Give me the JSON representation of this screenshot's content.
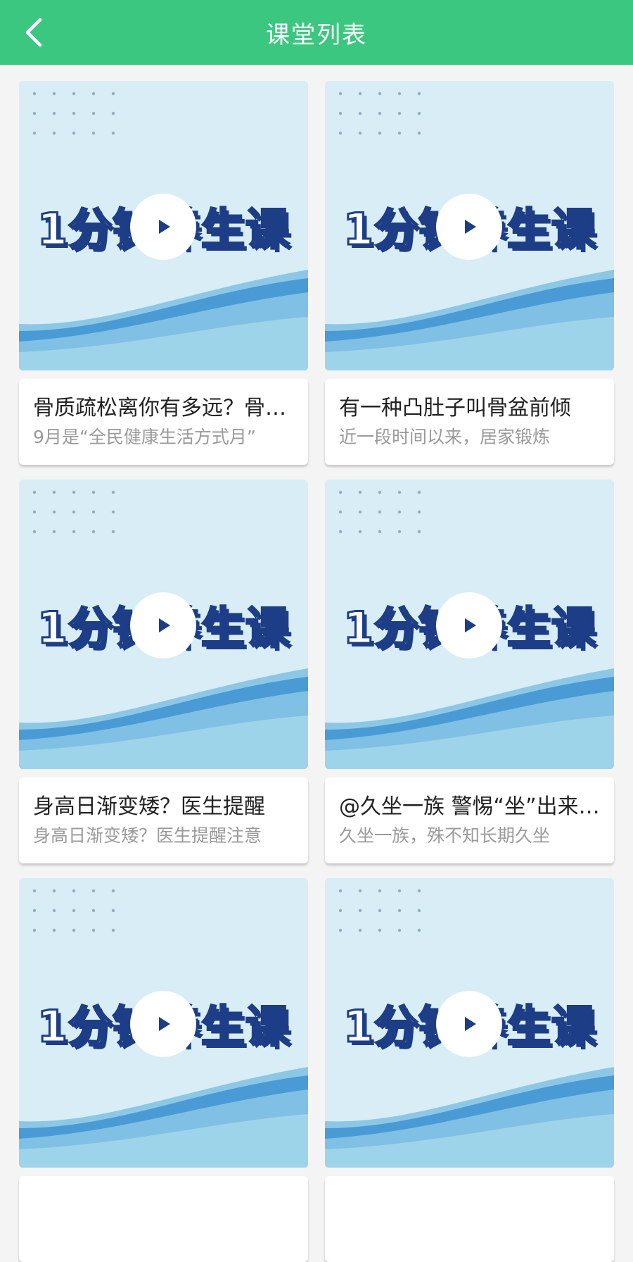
{
  "header": {
    "title": "课堂列表",
    "back_icon": "chevron-left-icon",
    "background": "#3cc780"
  },
  "thumbnail": {
    "banner_text": "1分钟养生课",
    "play_icon": "play-icon"
  },
  "courses": [
    {
      "title": "骨质疏松离你有多远？骨质疏松离你有多远？",
      "desc": "9月是“全民健康生活方式月”"
    },
    {
      "title": "有一种凸肚子叫骨盆前倾",
      "desc": "近一段时间以来，居家锻炼"
    },
    {
      "title": "身高日渐变矮？医生提醒",
      "desc": "身高日渐变矮？医生提醒注意"
    },
    {
      "title": "@久坐一族 警惕“坐”出来的病",
      "desc": "久坐一族，殊不知长期久坐"
    },
    {
      "title": "",
      "desc": ""
    },
    {
      "title": "",
      "desc": ""
    }
  ]
}
